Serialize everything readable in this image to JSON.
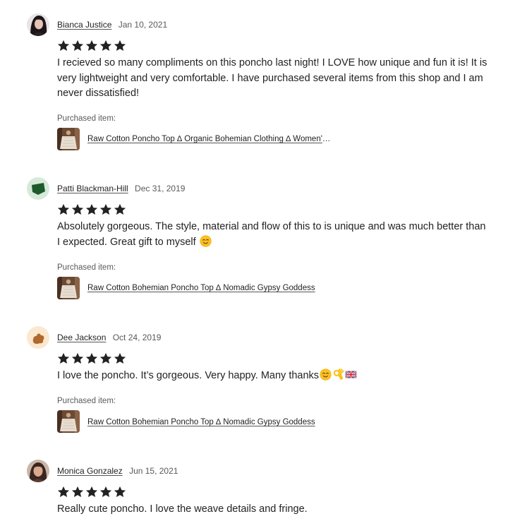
{
  "reviews": [
    {
      "reviewer": "Bianca Justice",
      "date": "Jan 10, 2021",
      "rating": 5,
      "avatar_icon": "profile-photo-icon",
      "text": "I recieved so many compliments on this poncho last night! I LOVE how unique and fun it is! It is very lightweight and very comfortable. I have purchased several items from this shop and I am never dissatisfied!",
      "purchased_label": "Purchased item:",
      "item_title": "Raw Cotton Poncho Top ∆ Organic Bohemian Clothing ∆ Women's Poncho"
    },
    {
      "reviewer": "Patti Blackman-Hill",
      "date": "Dec 31, 2019",
      "rating": 5,
      "avatar_icon": "green-leaf-icon",
      "text": "Absolutely gorgeous. The style, material and flow of this to is unique and was much better than I expected. Great gift to myself",
      "purchased_label": "Purchased item:",
      "item_title": "Raw Cotton Bohemian Poncho Top ∆ Nomadic Gypsy Goddess"
    },
    {
      "reviewer": "Dee Jackson",
      "date": "Oct 24, 2019",
      "rating": 5,
      "avatar_icon": "brown-blob-icon",
      "text": "I love the poncho. It’s gorgeous. Very happy. Many thanks",
      "purchased_label": "Purchased item:",
      "item_title": "Raw Cotton Bohemian Poncho Top ∆ Nomadic Gypsy Goddess"
    },
    {
      "reviewer": "Monica Gonzalez",
      "date": "Jun 15, 2021",
      "rating": 5,
      "avatar_icon": "profile-photo-icon",
      "text": "Really cute poncho. I love the weave details and fringe."
    }
  ],
  "colors": {
    "text": "#222222",
    "muted": "#595959",
    "star": "#222222",
    "avatar_green_bg": "#d7ead9",
    "avatar_green_leaf": "#1d5a2c",
    "avatar_tan_bg": "#fbe8cf",
    "avatar_brown": "#b0692c"
  }
}
